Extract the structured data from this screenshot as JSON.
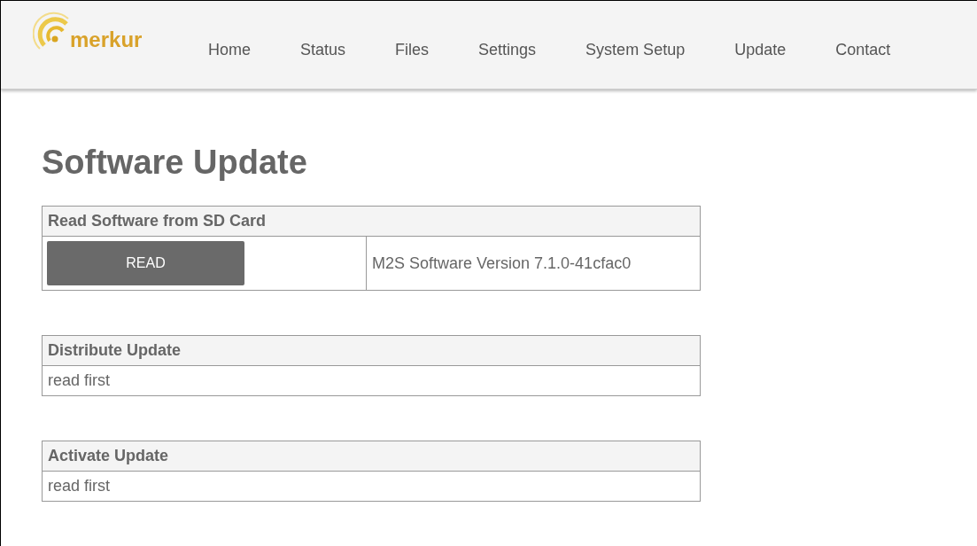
{
  "header": {
    "logo_text": "merkur",
    "nav": [
      "Home",
      "Status",
      "Files",
      "Settings",
      "System Setup",
      "Update",
      "Contact"
    ]
  },
  "title": "Software Update",
  "sections": [
    {
      "kind": "read",
      "heading": "Read Software from SD Card",
      "button": "READ",
      "value": "M2S Software Version 7.1.0-41cfac0"
    },
    {
      "kind": "text",
      "heading": "Distribute Update",
      "value": "read first"
    },
    {
      "kind": "text",
      "heading": "Activate Update",
      "value": "read first"
    }
  ]
}
